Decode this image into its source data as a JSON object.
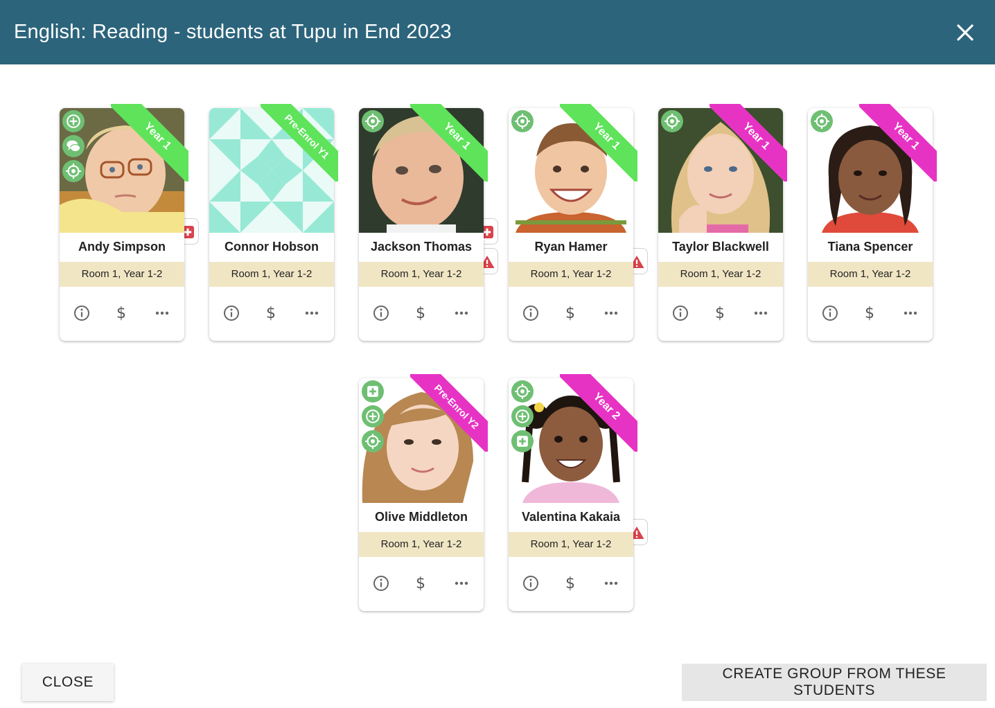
{
  "header": {
    "title": "English: Reading - students at Tupu in End 2023"
  },
  "students": [
    {
      "name": "Andy Simpson",
      "room": "Room 1, Year 1-2",
      "ribbon": "Year 1",
      "ribbon_color": "#5ee35a"
    },
    {
      "name": "Connor Hobson",
      "room": "Room 1, Year 1-2",
      "ribbon": "Pre-Enrol Y1",
      "ribbon_color": "#5ee35a"
    },
    {
      "name": "Jackson Thomas",
      "room": "Room 1, Year 1-2",
      "ribbon": "Year 1",
      "ribbon_color": "#5ee35a"
    },
    {
      "name": "Ryan Hamer",
      "room": "Room 1, Year 1-2",
      "ribbon": "Year 1",
      "ribbon_color": "#5ee35a"
    },
    {
      "name": "Taylor Blackwell",
      "room": "Room 1, Year 1-2",
      "ribbon": "Year 1",
      "ribbon_color": "#e733c4"
    },
    {
      "name": "Tiana Spencer",
      "room": "Room 1, Year 1-2",
      "ribbon": "Year 1",
      "ribbon_color": "#e733c4"
    },
    {
      "name": "Olive Middleton",
      "room": "Room 1, Year 1-2",
      "ribbon": "Pre-Enrol Y2",
      "ribbon_color": "#e733c4"
    },
    {
      "name": "Valentina Kakaia",
      "room": "Room 1, Year 1-2",
      "ribbon": "Year 2",
      "ribbon_color": "#e733c4"
    }
  ],
  "actions": {
    "dollar": "$"
  },
  "footer": {
    "close_label": "CLOSE",
    "create_label": "CREATE GROUP FROM THESE STUDENTS"
  },
  "colors": {
    "header_bg": "#2c647c",
    "room_bg": "#f1e6c4",
    "badge_green": "#6fbf73",
    "alert_red": "#d9434b"
  }
}
